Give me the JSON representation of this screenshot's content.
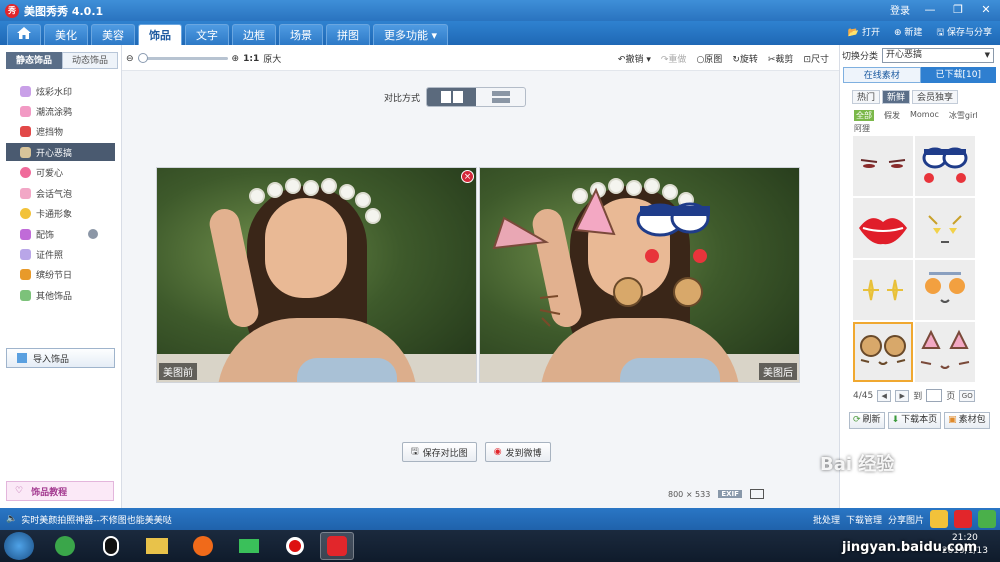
{
  "app": {
    "title": "美图秀秀 4.0.1",
    "logo_text": "秀"
  },
  "titlebar": {
    "login": "登录",
    "minimize": "—",
    "restore": "❐",
    "close": "✕"
  },
  "nav": {
    "tabs": [
      "美化",
      "美容",
      "饰品",
      "文字",
      "边框",
      "场景",
      "拼图",
      "更多功能"
    ],
    "active": "饰品",
    "open": "打开",
    "new": "新建",
    "save_share": "保存与分享"
  },
  "sidebar": {
    "tabs": [
      "静态饰品",
      "动态饰品"
    ],
    "items": [
      "炫彩水印",
      "潮流涂鸦",
      "遮挡物",
      "开心恶搞",
      "可爱心",
      "会话气泡",
      "卡通形象",
      "配饰",
      "证件照",
      "缤纷节日",
      "其他饰品"
    ],
    "active_item": "开心恶搞",
    "import": "导入饰品",
    "tutorial": "饰品教程"
  },
  "toolbar": {
    "zoom_label": "1:1",
    "original_size": "原大",
    "undo": "撤销",
    "redo": "重做",
    "original": "原图",
    "rotate": "旋转",
    "crop": "裁剪",
    "size": "尺寸"
  },
  "compare": {
    "label": "对比方式"
  },
  "photos": {
    "before_label": "美图前",
    "after_label": "美图后"
  },
  "bottom": {
    "save_compare": "保存对比图",
    "post_weibo": "发到微博"
  },
  "image_info": {
    "dimensions": "800 × 533",
    "exif": "EXIF"
  },
  "right": {
    "category_label": "切换分类",
    "category_value": "开心恶搞",
    "tabs": [
      "在线素材",
      "已下载[10]"
    ],
    "filters": [
      "热门",
      "新鲜",
      "会员独享"
    ],
    "active_filter": "新鲜",
    "tags": [
      "全部",
      "假发",
      "Momoc",
      "冰雪girl",
      "阿狸"
    ],
    "page": "4/45",
    "goto_prefix": "到",
    "goto_suffix": "页",
    "go": "GO",
    "refresh": "刷新",
    "download_page": "下载本页",
    "material_pack": "素材包"
  },
  "status": {
    "message": "实时美颜拍照神器--不修图也能美美哒",
    "batch": "批处理",
    "download_manager": "下载管理",
    "share_image": "分享图片"
  },
  "taskbar": {
    "time": "21:20",
    "date": "2019/1/13"
  },
  "watermark": {
    "logo": "Bai 经验",
    "url": "jingyan.baidu.com"
  },
  "colors": {
    "accent": "#2a73bf",
    "active_dark": "#4a5a70",
    "selection": "#f0a830"
  }
}
